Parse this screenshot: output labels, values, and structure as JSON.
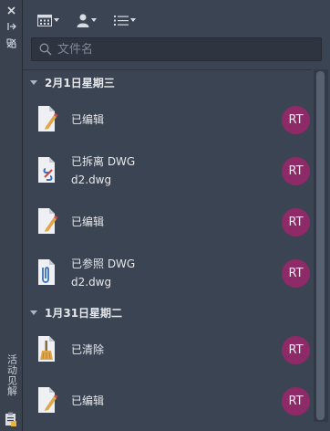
{
  "side": {
    "close_icon": "close-icon",
    "pin_icon": "pin-icon",
    "properties_icon": "properties-icon",
    "title": "活动见解",
    "bottom_icon": "clipboard-icon"
  },
  "toolbar": {
    "calendar_button": "calendar-icon",
    "user_button": "user-icon",
    "list_button": "list-icon"
  },
  "search": {
    "placeholder": "文件名"
  },
  "groups": [
    {
      "header": "2月1日星期三",
      "items": [
        {
          "icon": "edit-drawing-icon",
          "line1": "已编辑",
          "line2": "",
          "avatar": "RT"
        },
        {
          "icon": "detach-drawing-icon",
          "line1": "已拆离 DWG",
          "line2": "d2.dwg",
          "avatar": "RT"
        },
        {
          "icon": "edit-drawing-icon",
          "line1": "已编辑",
          "line2": "",
          "avatar": "RT"
        },
        {
          "icon": "attach-drawing-icon",
          "line1": "已参照 DWG",
          "line2": "d2.dwg",
          "avatar": "RT"
        }
      ]
    },
    {
      "header": "1月31日星期二",
      "items": [
        {
          "icon": "purge-drawing-icon",
          "line1": "已清除",
          "line2": "",
          "avatar": "RT"
        },
        {
          "icon": "edit-drawing-icon",
          "line1": "已编辑",
          "line2": "",
          "avatar": "RT"
        }
      ]
    }
  ],
  "colors": {
    "avatar_bg": "#8f2a68",
    "panel_bg": "#3b4452",
    "side_bg": "#3a4250"
  }
}
